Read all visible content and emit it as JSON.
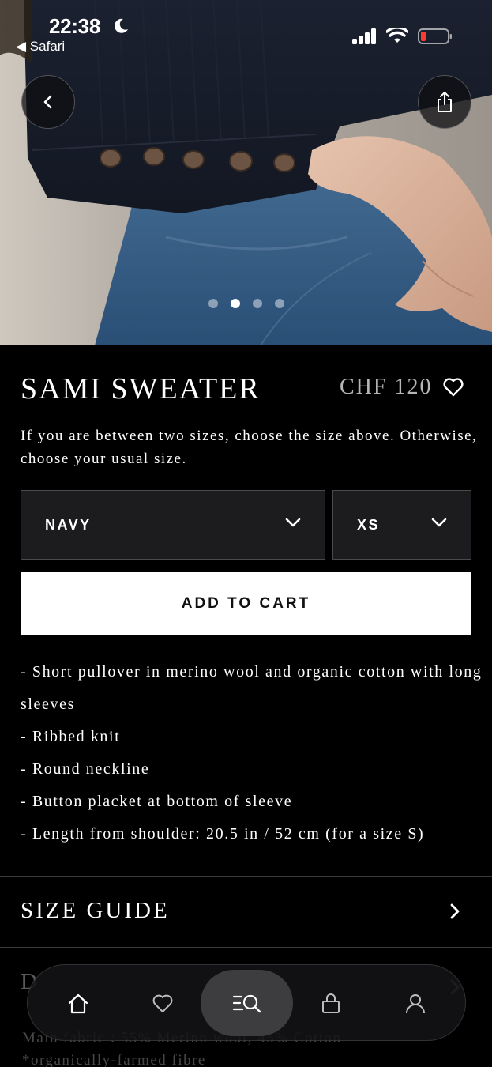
{
  "status_bar": {
    "time": "22:38",
    "back_app": "◀ Safari"
  },
  "hero": {
    "carousel_total": 4,
    "carousel_active_index": 1
  },
  "product": {
    "title": "SAMI SWEATER",
    "price": "CHF 120",
    "size_hint": "If you are between two sizes, choose the size above. Otherwise, choose your usual size.",
    "color_select": "NAVY",
    "size_select": "XS",
    "add_to_cart": "ADD TO CART",
    "description": [
      "- Short pullover in merino wool and organic cotton with long sleeves",
      "- Ribbed knit",
      "- Round neckline",
      "- Button placket at bottom of sleeve",
      "- Length from shoulder: 20.5 in / 52 cm (for a size S)"
    ]
  },
  "sections": {
    "size_guide": "SIZE GUIDE",
    "details_partial": "D",
    "fabric_partial": "Main fabric : 55% Merino wool, 45% Cotton",
    "fabric_note_partial": "*organically-farmed fibre"
  },
  "tab_bar": {
    "active": "search",
    "items": [
      "home-icon",
      "heart-icon",
      "search-menu-icon",
      "bag-icon",
      "account-icon"
    ]
  },
  "colors": {
    "background": "#000000",
    "button_bg": "#ffffff",
    "select_bg": "#1c1c1e",
    "price": "#b7b7b7",
    "battery_low": "#ff3b30"
  }
}
